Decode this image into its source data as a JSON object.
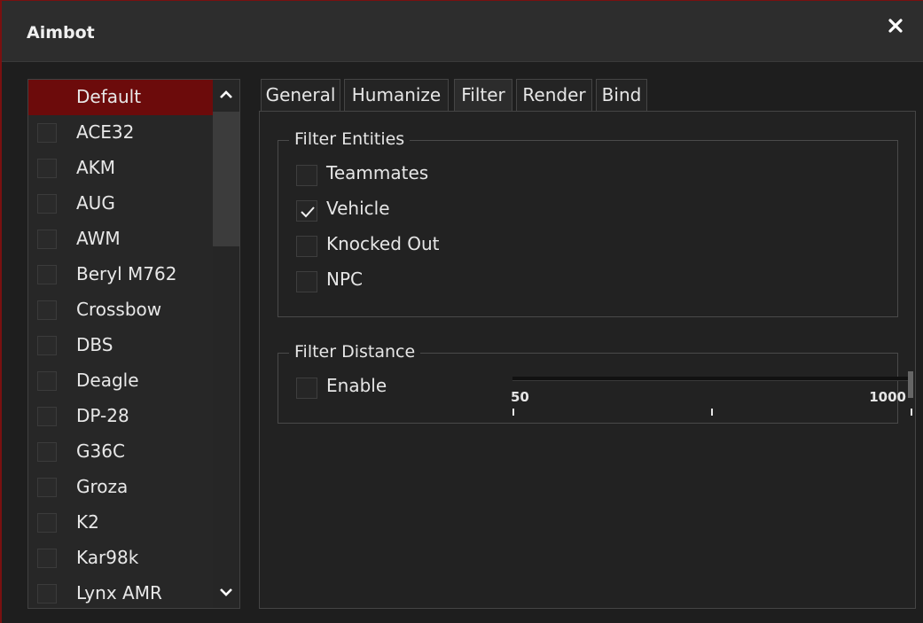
{
  "window": {
    "title": "Aimbot",
    "close_icon": "close-icon"
  },
  "weapon_list": {
    "items": [
      {
        "label": "Default",
        "selected": true
      },
      {
        "label": "ACE32"
      },
      {
        "label": "AKM"
      },
      {
        "label": "AUG"
      },
      {
        "label": "AWM"
      },
      {
        "label": "Beryl M762"
      },
      {
        "label": "Crossbow"
      },
      {
        "label": "DBS"
      },
      {
        "label": "Deagle"
      },
      {
        "label": "DP-28"
      },
      {
        "label": "G36C"
      },
      {
        "label": "Groza"
      },
      {
        "label": "K2"
      },
      {
        "label": "Kar98k"
      },
      {
        "label": "Lynx AMR"
      }
    ]
  },
  "tabs": [
    {
      "label": "General"
    },
    {
      "label": "Humanize"
    },
    {
      "label": "Filter",
      "active": true
    },
    {
      "label": "Render"
    },
    {
      "label": "Bind"
    }
  ],
  "filter_entities": {
    "title": "Filter Entities",
    "options": [
      {
        "label": "Teammates",
        "checked": false
      },
      {
        "label": "Vehicle",
        "checked": true
      },
      {
        "label": "Knocked Out",
        "checked": false
      },
      {
        "label": "NPC",
        "checked": false
      }
    ]
  },
  "filter_distance": {
    "title": "Filter Distance",
    "enable_label": "Enable",
    "enable_checked": false,
    "slider_min": "50",
    "slider_max": "1000",
    "slider_value": 1000
  },
  "colors": {
    "selected_item": "#6c0b0b",
    "accent_border": "#7a1010"
  }
}
